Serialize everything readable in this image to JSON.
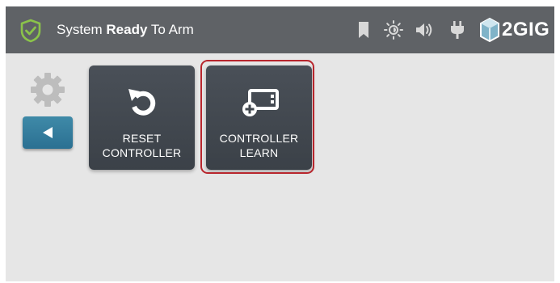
{
  "status": {
    "prefix": "System ",
    "bold": "Ready",
    "suffix": " To Arm"
  },
  "brand": {
    "name": "2GIG"
  },
  "toolbar_icons": [
    "bookmark-icon",
    "brightness-icon",
    "volume-icon",
    "power-plug-icon"
  ],
  "tiles": [
    {
      "line1": "RESET",
      "line2": "CONTROLLER",
      "icon": "reset-arrow-icon",
      "selected": false
    },
    {
      "line1": "CONTROLLER",
      "line2": "LEARN",
      "icon": "controller-add-icon",
      "selected": true
    }
  ],
  "colors": {
    "topbar": "#5f6266",
    "background": "#e6e6e6",
    "tile": "#42484f",
    "back_button": "#3380a0",
    "accent_green": "#8bc34a",
    "selection": "#b8262d"
  }
}
